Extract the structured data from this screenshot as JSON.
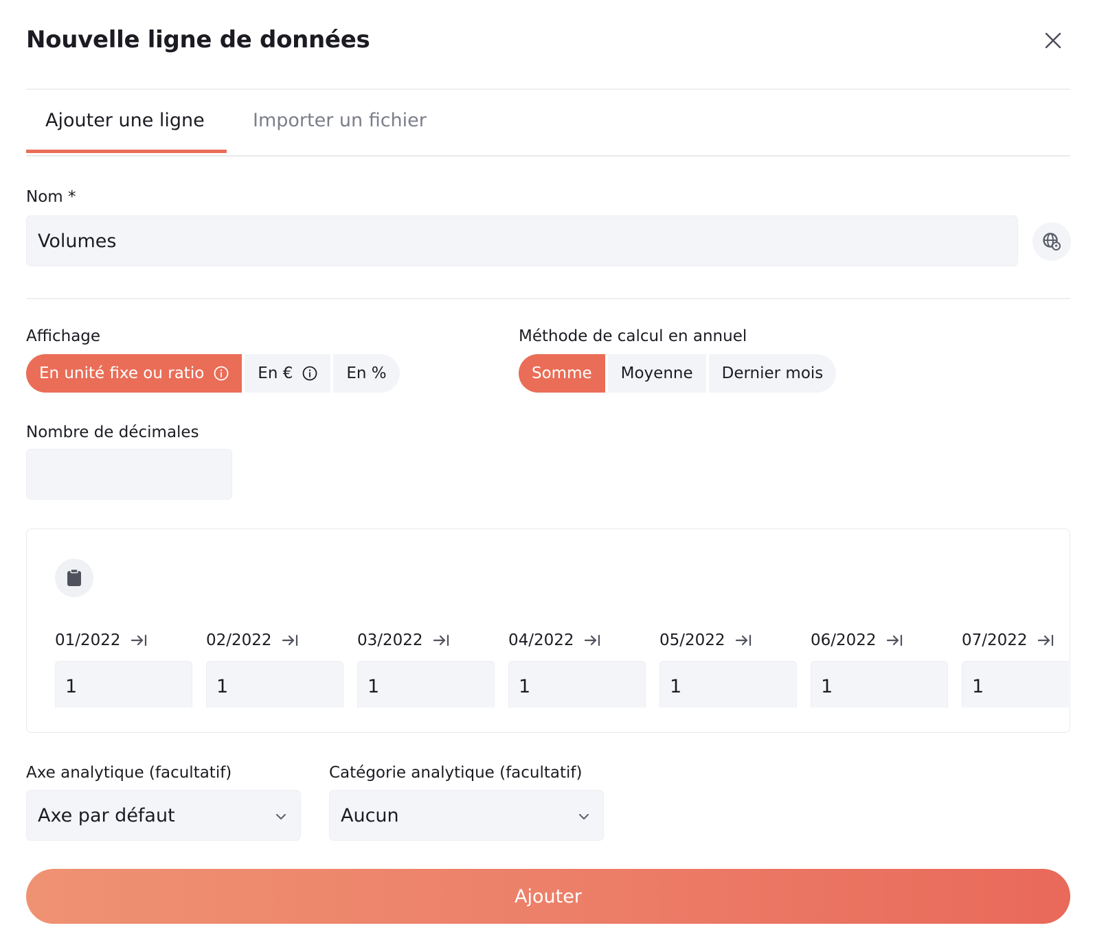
{
  "dialog": {
    "title": "Nouvelle ligne de données"
  },
  "tabs": [
    {
      "label": "Ajouter une ligne",
      "active": true
    },
    {
      "label": "Importer un fichier",
      "active": false
    }
  ],
  "name_field": {
    "label": "Nom *",
    "value": "Volumes"
  },
  "affichage": {
    "label": "Affichage",
    "options": [
      {
        "label": "En unité fixe ou ratio",
        "selected": true,
        "info_icon": "info-icon"
      },
      {
        "label": "En €",
        "selected": false,
        "info_icon": "info-icon"
      },
      {
        "label": "En %",
        "selected": false
      }
    ]
  },
  "calcul": {
    "label": "Méthode de calcul en annuel",
    "options": [
      {
        "label": "Somme",
        "selected": true
      },
      {
        "label": "Moyenne",
        "selected": false
      },
      {
        "label": "Dernier mois",
        "selected": false
      }
    ]
  },
  "decimales": {
    "label": "Nombre de décimales",
    "value": ""
  },
  "months": [
    {
      "label": "01/2022",
      "value": "1"
    },
    {
      "label": "02/2022",
      "value": "1"
    },
    {
      "label": "03/2022",
      "value": "1"
    },
    {
      "label": "04/2022",
      "value": "1"
    },
    {
      "label": "05/2022",
      "value": "1"
    },
    {
      "label": "06/2022",
      "value": "1"
    },
    {
      "label": "07/2022",
      "value": "1"
    }
  ],
  "axe": {
    "label": "Axe analytique (facultatif)",
    "value": "Axe par défaut"
  },
  "categorie": {
    "label": "Catégorie analytique (facultatif)",
    "value": "Aucun"
  },
  "submit": {
    "label": "Ajouter"
  },
  "colors": {
    "accent": "#ea6d57",
    "field_bg": "#f4f5f9"
  }
}
